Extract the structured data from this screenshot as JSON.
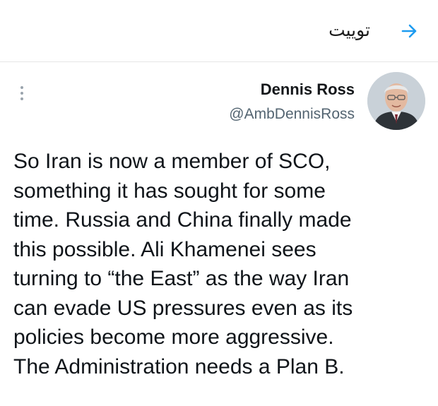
{
  "header": {
    "title": "توییت",
    "back_icon": "arrow-right-icon",
    "accent_color": "#1d9bf0"
  },
  "tweet": {
    "display_name": "Dennis Ross",
    "handle": "@AmbDennisRoss",
    "more_icon": "more-vertical-icon",
    "text_lines": [
      "So Iran is now a member of SCO,",
      "something it has sought for some",
      "time. Russia and China finally made",
      "this possible. Ali Khamenei sees",
      "turning to “the East” as the way Iran",
      "can evade US pressures even as its",
      "policies become more aggressive.",
      "The Administration needs a Plan B."
    ]
  }
}
